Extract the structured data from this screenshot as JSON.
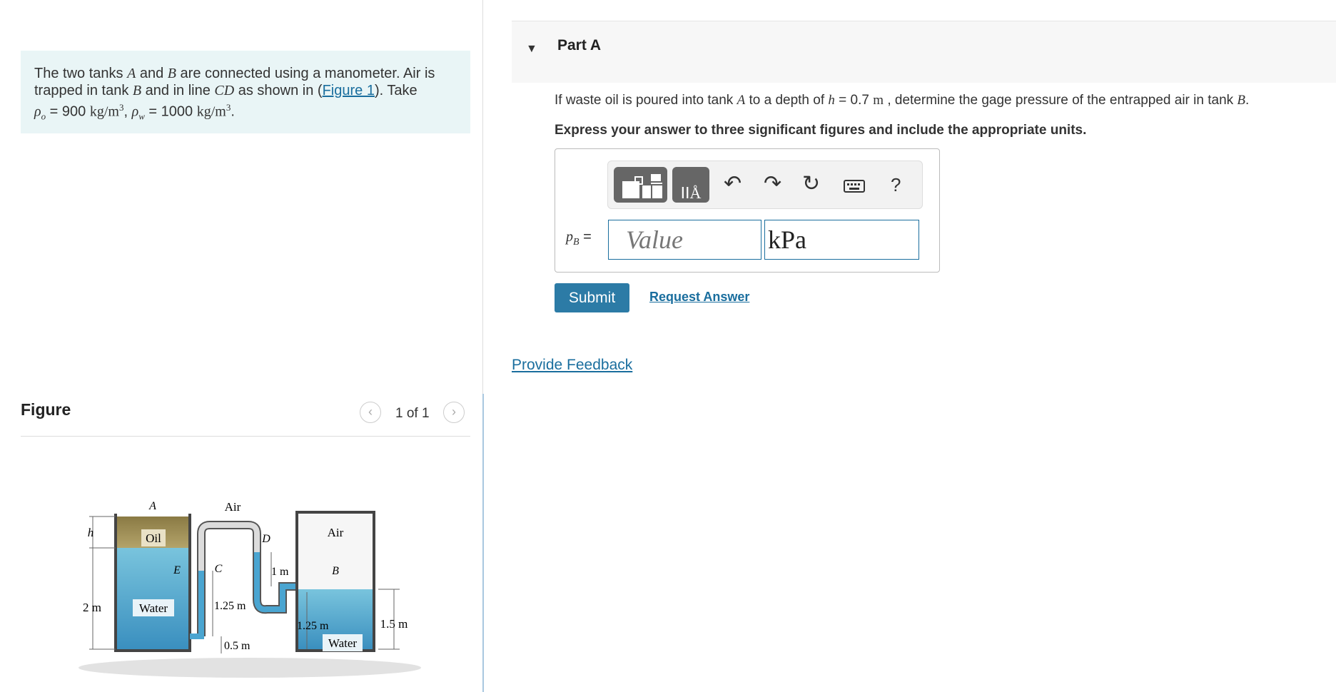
{
  "problem": {
    "line1_a": "The two tanks ",
    "var_A": "A",
    "line1_b": " and ",
    "var_B": "B",
    "line1_c": " are connected using a manometer. Air is",
    "line2_a": "trapped in tank ",
    "line2_b": " and in line ",
    "var_CD": "CD",
    "line2_c": " as shown in (",
    "figure_link": "Figure 1",
    "line2_d": "). Take",
    "rho_o": "ρ",
    "rho_o_sub": "o",
    "rho_o_val": " = 900 ",
    "unit1": "kg/m",
    "exp": "3",
    "comma": ", ",
    "rho_w": "ρ",
    "rho_w_sub": "w",
    "rho_w_val": " = 1000 ",
    "unit2": "kg/m",
    "period": "."
  },
  "figure_panel": {
    "title": "Figure",
    "pager": "1 of 1",
    "prev_icon": "chevron-left-icon",
    "next_icon": "chevron-right-icon"
  },
  "figure": {
    "labels": {
      "A": "A",
      "h": "h",
      "oil": "Oil",
      "E": "E",
      "water_a": "Water",
      "two_m": "2 m",
      "air_top": "Air",
      "C": "C",
      "D": "D",
      "one_m": "1 m",
      "one_25_left": "1.25 m",
      "half_m": "0.5 m",
      "air_b": "Air",
      "B": "B",
      "one_25_right": "1.25 m",
      "water_b": "Water",
      "one_5_m": "1.5 m"
    }
  },
  "part": {
    "caret_icon": "triangle-down-icon",
    "label": "Part A",
    "q_a": "If waste oil is poured into tank ",
    "q_A": "A",
    "q_b": " to a depth of ",
    "q_h": "h",
    "q_c": " = 0.7 ",
    "q_m": "m",
    "q_d": " , determine the gage pressure of the entrapped air in tank ",
    "q_B": "B",
    "q_e": ".",
    "instruction": "Express your answer to three significant figures and include the appropriate units."
  },
  "answer": {
    "toolbar": [
      "templates-icon",
      "symbols-icon",
      "undo-icon",
      "redo-icon",
      "reset-icon",
      "keyboard-icon",
      "help-icon"
    ],
    "help_label": "?",
    "pb_var": "p",
    "pb_sub": "B",
    "pb_eq": " =",
    "value_placeholder": "Value",
    "unit_value": "kPa"
  },
  "buttons": {
    "submit": "Submit",
    "request": "Request Answer",
    "feedback": "Provide Feedback"
  }
}
